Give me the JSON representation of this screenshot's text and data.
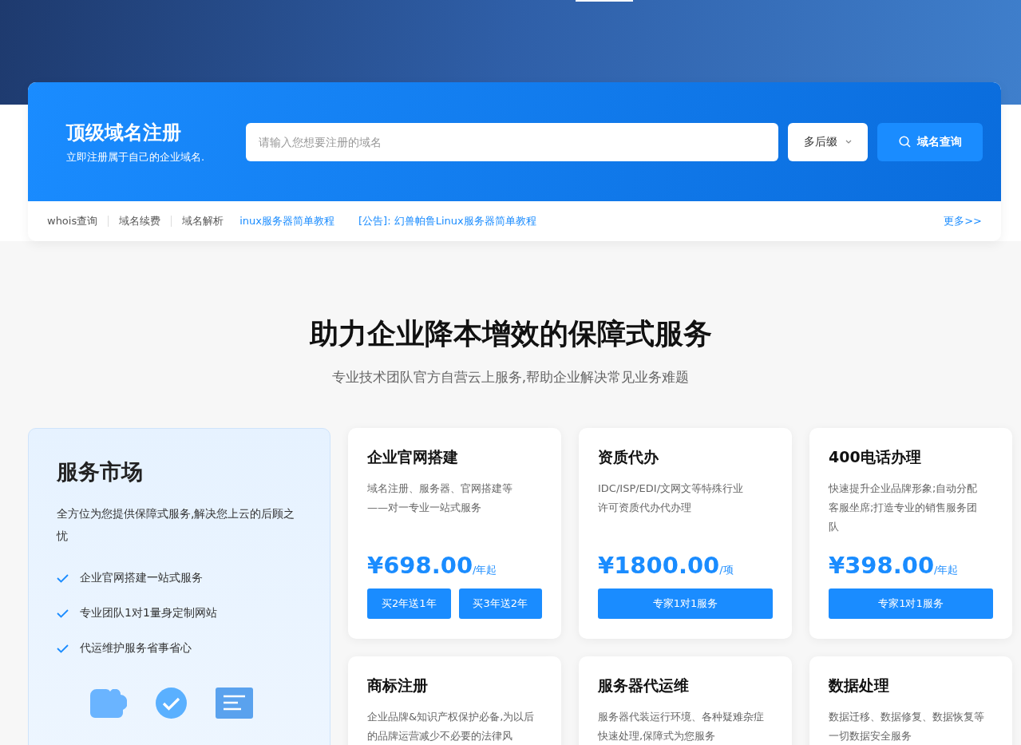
{
  "domain_search": {
    "title": "顶级域名注册",
    "subtitle": "立即注册属于自己的企业域名.",
    "placeholder": "请输入您想要注册的域名",
    "suffix_select": "多后缀",
    "search_button": "域名查询"
  },
  "quick_links": [
    {
      "label": "whois查询",
      "kind": "plain"
    },
    {
      "label": "域名续费",
      "kind": "plain"
    },
    {
      "label": "域名解析",
      "kind": "plain"
    },
    {
      "label": "inux服务器简单教程",
      "kind": "news"
    },
    {
      "label": "[公告]: 幻兽帕鲁Linux服务器简单教程",
      "kind": "news"
    }
  ],
  "more_link": "更多>>",
  "section": {
    "title": "助力企业降本增效的保障式服务",
    "subtitle": "专业技术团队官方自营云上服务,帮助企业解决常见业务难题"
  },
  "market": {
    "title": "服务市场",
    "description": "全方位为您提供保障式服务,解决您上云的后顾之忧",
    "features": [
      "企业官网搭建一站式服务",
      "专业团队1对1量身定制网站",
      "代运维护服务省事省心"
    ]
  },
  "services": [
    {
      "title": "企业官网搭建",
      "description": "域名注册、服务器、官网搭建等——对一专业一站式服务",
      "price": "¥698.00",
      "unit": "/年起",
      "buttons": [
        "买2年送1年",
        "买3年送2年"
      ]
    },
    {
      "title": "资质代办",
      "description": "IDC/ISP/EDI/文网文等特殊行业许可资质代办代办理",
      "price": "¥1800.00",
      "unit": "/项",
      "buttons": [
        "专家1对1服务"
      ]
    },
    {
      "title": "400电话办理",
      "description": "快速提升企业品牌形象;自动分配客服坐席;打造专业的销售服务团队",
      "price": "¥398.00",
      "unit": "/年起",
      "buttons": [
        "专家1对1服务"
      ]
    },
    {
      "title": "商标注册",
      "description": "企业品牌&知识产权保护必备,为以后的品牌运营减少不必要的法律风"
    },
    {
      "title": "服务器代运维",
      "description": "服务器代装运行环境、各种疑难杂症快速处理,保障式为您服务"
    },
    {
      "title": "数据处理",
      "description": "数据迁移、数据修复、数据恢复等一切数据安全服务"
    }
  ]
}
